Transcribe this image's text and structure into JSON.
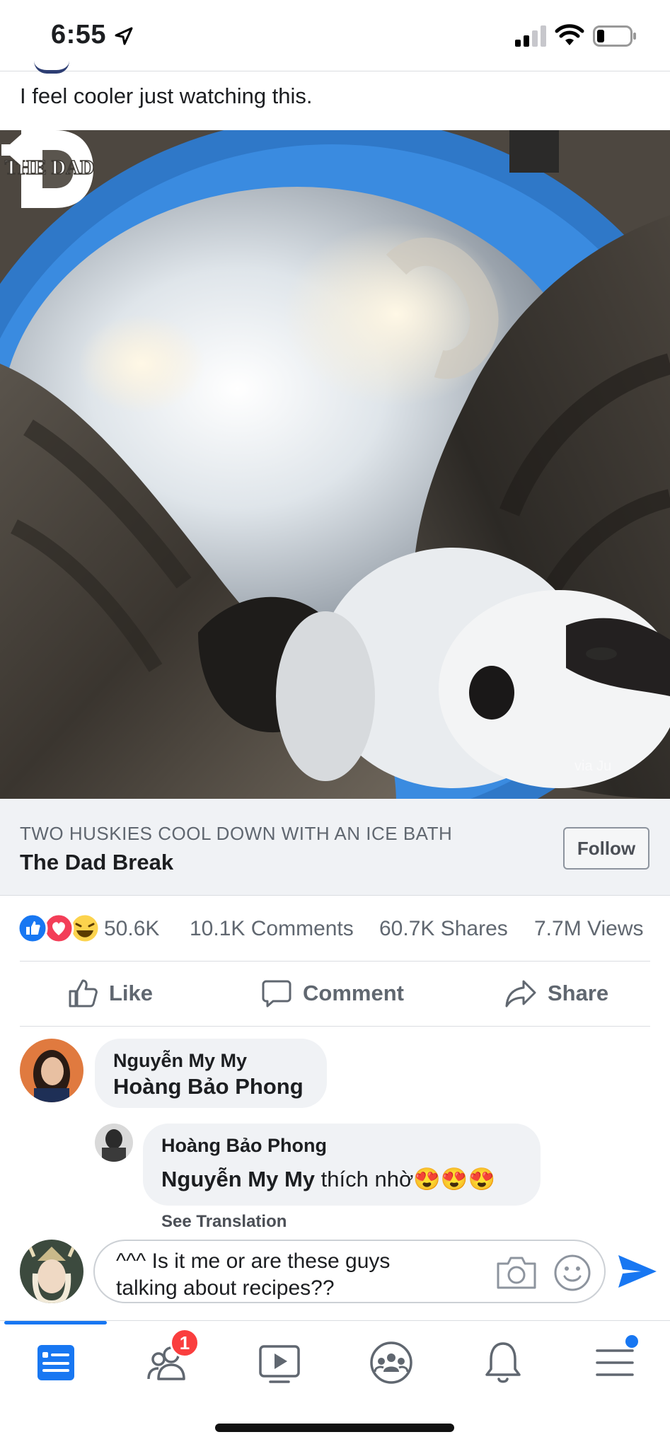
{
  "status_bar": {
    "time": "6:55"
  },
  "post": {
    "caption": "I feel cooler just watching this.",
    "video": {
      "watermark": "THE DAD",
      "via_text": "via Ju"
    },
    "attribution": {
      "subtitle": "TWO HUSKIES COOL DOWN WITH AN ICE BATH",
      "title": "The Dad Break",
      "follow_label": "Follow"
    },
    "stats": {
      "reactions": "50.6K",
      "comments": "10.1K Comments",
      "shares": "60.7K Shares",
      "views": "7.7M Views"
    },
    "actions": {
      "like": "Like",
      "comment": "Comment",
      "share": "Share"
    }
  },
  "comments": [
    {
      "author": "Nguyễn My My",
      "text": "Hoàng Bảo Phong"
    },
    {
      "author": "Hoàng Bảo Phong",
      "mention": "Nguyễn My My",
      "text": " thích nhờ😍😍😍",
      "see_translation": "See Translation"
    }
  ],
  "composer": {
    "text": "^^^ Is it me or are these guys talking about recipes??"
  },
  "tabbar": {
    "friends_badge": "1"
  },
  "colors": {
    "accent": "#1877f2",
    "badge": "#fa3e3e"
  }
}
